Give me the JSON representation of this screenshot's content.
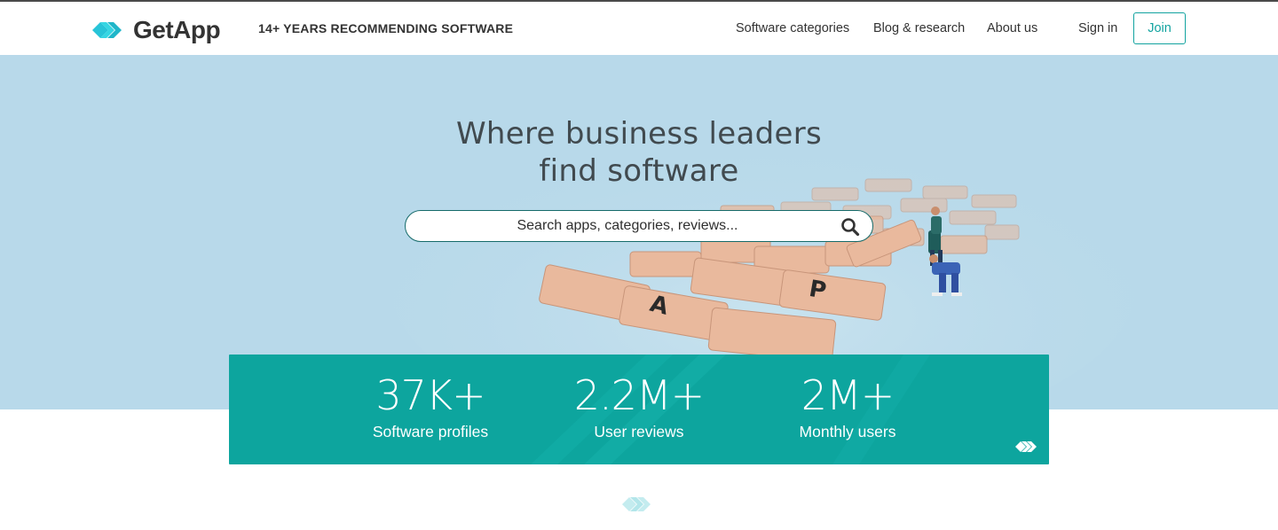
{
  "header": {
    "logo_text": "GetApp",
    "tagline": "14+ YEARS RECOMMENDING SOFTWARE",
    "nav": {
      "software_categories": "Software categories",
      "blog_research": "Blog & research",
      "about_us": "About us",
      "sign_in": "Sign in",
      "join": "Join"
    }
  },
  "hero": {
    "title_line1": "Where business leaders",
    "title_line2": "find software",
    "search_placeholder": "Search apps, categories, reviews..."
  },
  "stats": [
    {
      "value": "37K+",
      "label": "Software profiles"
    },
    {
      "value": "2.2M+",
      "label": "User reviews"
    },
    {
      "value": "2M+",
      "label": "Monthly users"
    }
  ],
  "colors": {
    "brand_teal": "#0da59e",
    "hero_bg": "#b8d9ea",
    "logo_cyan": "#2ed3e0"
  },
  "icons": {
    "logo": "getapp-chevrons-icon",
    "search": "search-icon",
    "stats_mark": "getapp-chevrons-icon"
  }
}
